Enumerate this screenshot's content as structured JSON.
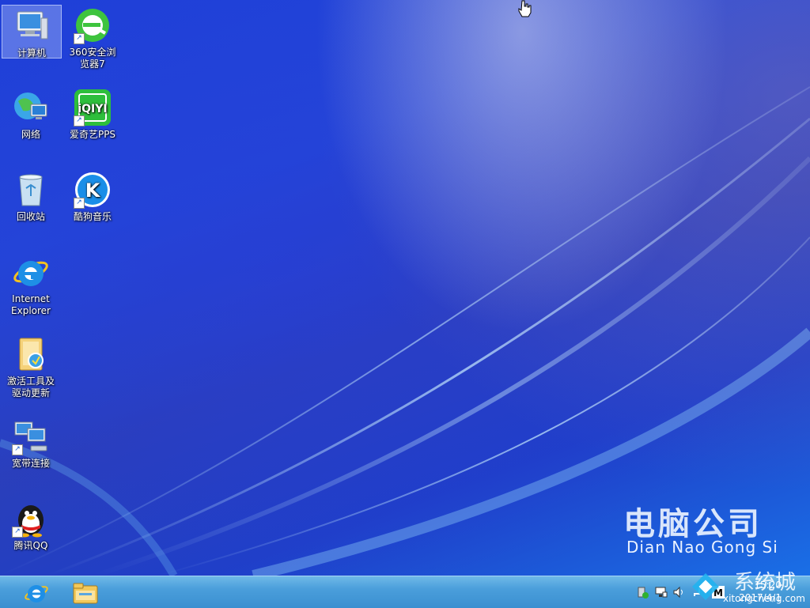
{
  "desktop": {
    "icons": [
      {
        "label": "计算机",
        "icon": "computer-icon"
      },
      {
        "label": "360安全浏览器7",
        "icon": "browser-360-icon"
      },
      {
        "label": "网络",
        "icon": "network-globe-icon"
      },
      {
        "label": "爱奇艺PPS",
        "icon": "iqiyi-icon"
      },
      {
        "label": "回收站",
        "icon": "recycle-bin-icon"
      },
      {
        "label": "酷狗音乐",
        "icon": "kugou-icon"
      },
      {
        "label": "Internet Explorer",
        "icon": "ie-icon"
      },
      {
        "label": "激活工具及驱动更新",
        "icon": "folder-tools-icon"
      },
      {
        "label": "宽带连接",
        "icon": "broadband-icon"
      },
      {
        "label": "腾讯QQ",
        "icon": "qq-penguin-icon"
      }
    ]
  },
  "wallpaper": {
    "brand_cn": "电脑公司",
    "brand_en": "Dian Nao Gong Si"
  },
  "taskbar": {
    "pinned": [
      {
        "icon": "ie-icon"
      },
      {
        "icon": "file-explorer-icon"
      }
    ],
    "clock": {
      "time": "15:20",
      "date": "2017/4/1"
    }
  },
  "watermark": {
    "cn": "系统城",
    "url": "xitongcheng.com"
  },
  "colors": {
    "taskbar": "#4a9edb",
    "desktop": "#1f3fc8"
  }
}
